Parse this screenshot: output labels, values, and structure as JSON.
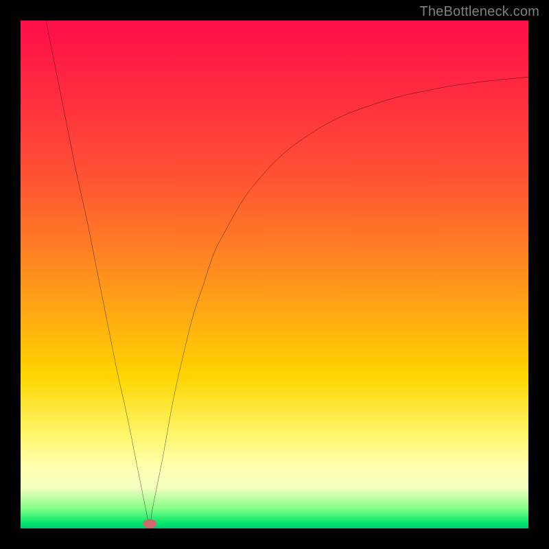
{
  "watermark": "TheBottleneck.com",
  "marker": {
    "x_pct": 25.4,
    "y_pct": 99.0
  },
  "colors": {
    "curve": "#000000",
    "border": "#000000",
    "marker": "#cf6a6a"
  },
  "chart_data": {
    "type": "line",
    "title": "",
    "xlabel": "",
    "ylabel": "",
    "xlim": [
      0,
      100
    ],
    "ylim": [
      0,
      100
    ],
    "grid": false,
    "legend": false,
    "series": [
      {
        "name": "curve",
        "x": [
          5,
          7,
          9,
          11,
          13,
          15,
          17,
          19,
          21,
          23,
          25,
          25.4,
          26,
          28,
          30,
          32,
          34,
          36,
          38,
          40,
          44,
          48,
          52,
          56,
          60,
          64,
          68,
          72,
          76,
          80,
          84,
          88,
          92,
          96,
          100
        ],
        "y": [
          100,
          90,
          80,
          70,
          61,
          51,
          41,
          31,
          22,
          12,
          2,
          0,
          4,
          14,
          25,
          34,
          42,
          48,
          54,
          58,
          65,
          70,
          74,
          77,
          79.5,
          81.5,
          83,
          84.3,
          85.4,
          86.2,
          87,
          87.6,
          88.1,
          88.5,
          88.9
        ]
      }
    ],
    "annotations": []
  }
}
